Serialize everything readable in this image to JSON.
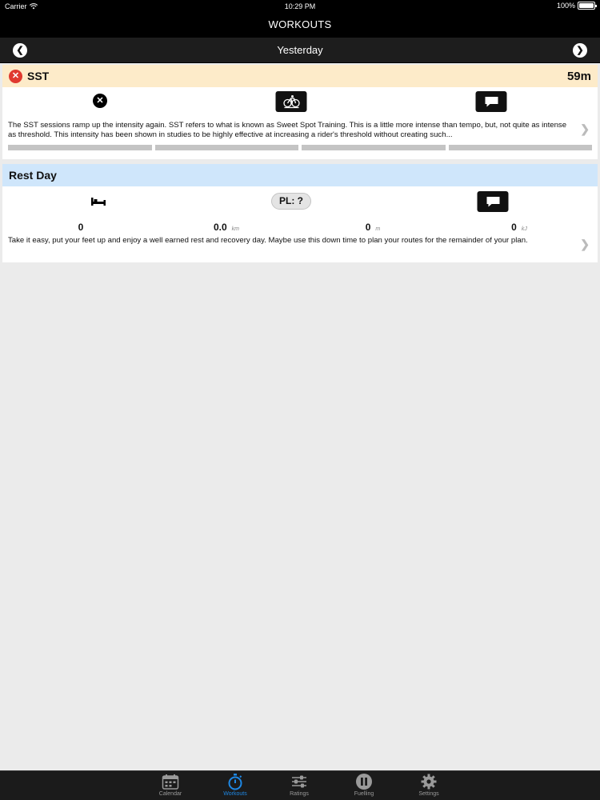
{
  "status_bar": {
    "carrier": "Carrier",
    "time": "10:29 PM",
    "battery": "100%"
  },
  "header": {
    "title": "WORKOUTS"
  },
  "day_nav": {
    "label": "Yesterday"
  },
  "workouts": [
    {
      "name": "SST",
      "duration": "59m",
      "description": "The SST sessions ramp up the intensity again. SST refers to what is known as Sweet Spot Training. This is a little more intense than tempo, but, not quite as intense as threshold. This intensity has been shown in studies to be highly effective at increasing a rider's threshold without creating such..."
    },
    {
      "name": "Rest Day",
      "pl_label": "PL: ?",
      "metrics": [
        {
          "value": "0",
          "unit": ""
        },
        {
          "value": "0.0",
          "unit": "km"
        },
        {
          "value": "0",
          "unit": "m"
        },
        {
          "value": "0",
          "unit": "kJ"
        }
      ],
      "description": "Take it easy, put your feet up and enjoy a well earned rest and recovery day. Maybe use this down time to plan your routes for the remainder of your plan."
    }
  ],
  "tabs": [
    {
      "label": "Calendar",
      "icon": "calendar-icon"
    },
    {
      "label": "Workouts",
      "icon": "stopwatch-icon"
    },
    {
      "label": "Ratings",
      "icon": "sliders-icon"
    },
    {
      "label": "Fuelling",
      "icon": "pause-circle-icon"
    },
    {
      "label": "Settings",
      "icon": "gear-icon"
    }
  ],
  "colors": {
    "sst_header_bg": "#fdebc9",
    "rest_header_bg": "#cfe6fb",
    "status_red": "#e0392f",
    "active_tab": "#1e88e5"
  }
}
